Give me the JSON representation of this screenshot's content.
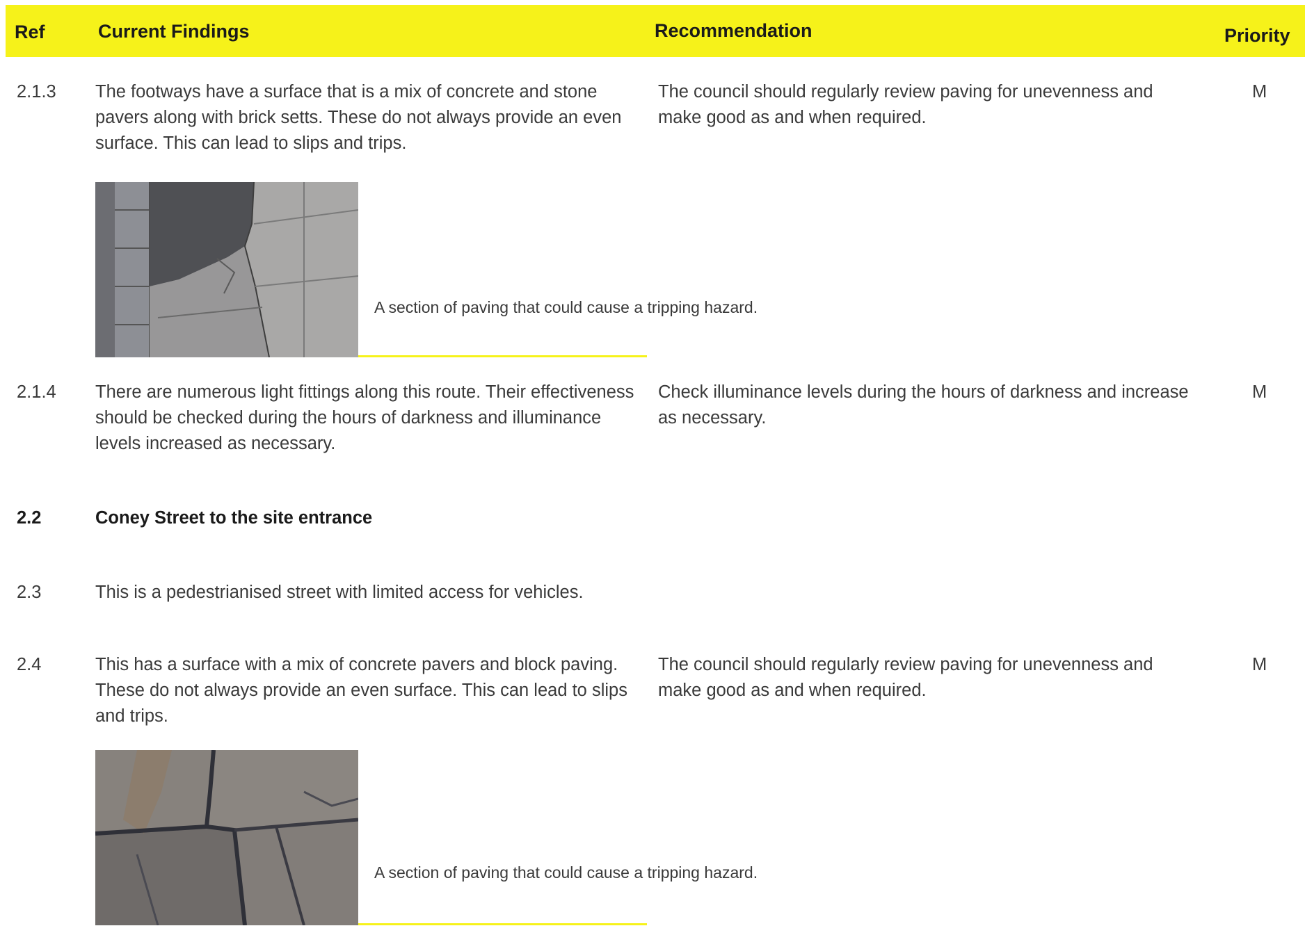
{
  "header": {
    "ref": "Ref",
    "findings": "Current Findings",
    "recommendation": "Recommendation",
    "priority": "Priority"
  },
  "rows": [
    {
      "ref": "2.1.3",
      "findings": "The footways have a surface that is a mix of concrete and stone pavers along with brick setts. These do not always provide an even surface. This can lead to slips and trips.",
      "recommendation": "The council should regularly review paving for unevenness and make good as and when required.",
      "priority": "M",
      "caption": "A section of paving that could cause a tripping hazard."
    },
    {
      "ref": "2.1.4",
      "findings": "There are numerous light fittings along this route. Their effectiveness should be checked during the hours of darkness and illuminance levels increased as necessary.",
      "recommendation": "Check illuminance levels during the hours of darkness and increase as necessary.",
      "priority": "M"
    },
    {
      "ref": "2.2",
      "findings": "Coney Street to the site entrance"
    },
    {
      "ref": "2.3",
      "findings": "This is a pedestrianised street with limited access for vehicles."
    },
    {
      "ref": "2.4",
      "findings": "This has a surface with a mix of concrete pavers and block paving. These do not always provide an even surface. This can lead to slips and trips.",
      "recommendation": "The council should regularly review paving for unevenness and make good as and when required.",
      "priority": "M",
      "caption": "A section of paving that could cause a tripping hazard."
    }
  ]
}
